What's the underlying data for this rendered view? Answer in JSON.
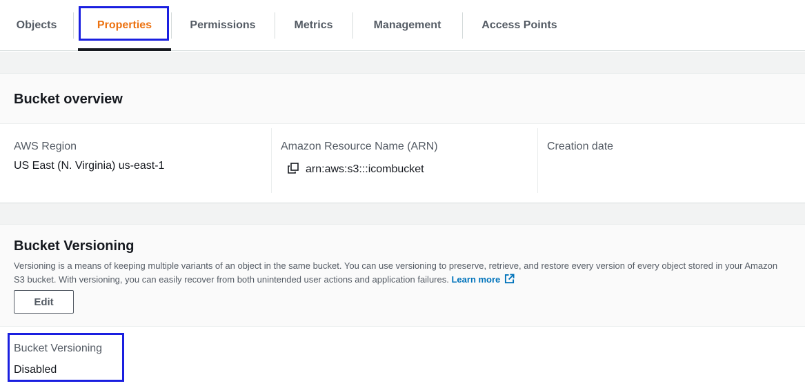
{
  "tabs": [
    {
      "label": "Objects"
    },
    {
      "label": "Properties",
      "active": true
    },
    {
      "label": "Permissions"
    },
    {
      "label": "Metrics"
    },
    {
      "label": "Management"
    },
    {
      "label": "Access Points"
    }
  ],
  "overview": {
    "title": "Bucket overview",
    "region_label": "AWS Region",
    "region_value": "US East (N. Virginia) us-east-1",
    "arn_label": "Amazon Resource Name (ARN)",
    "arn_value": "arn:aws:s3:::icombucket",
    "arn_icon": "copy-icon",
    "creation_label": "Creation date"
  },
  "versioning": {
    "title": "Bucket Versioning",
    "description": "Versioning is a means of keeping multiple variants of an object in the same bucket. You can use versioning to preserve, retrieve, and restore every version of every object stored in your Amazon S3 bucket. With versioning, you can easily recover from both unintended user actions and application failures.",
    "learn_more": "Learn more",
    "learn_more_icon": "external-link-icon",
    "edit_label": "Edit",
    "status_label": "Bucket Versioning",
    "status_value": "Disabled"
  },
  "colors": {
    "active_tab": "#ec7211",
    "link": "#0073bb",
    "highlight": "#1a1fe0"
  }
}
